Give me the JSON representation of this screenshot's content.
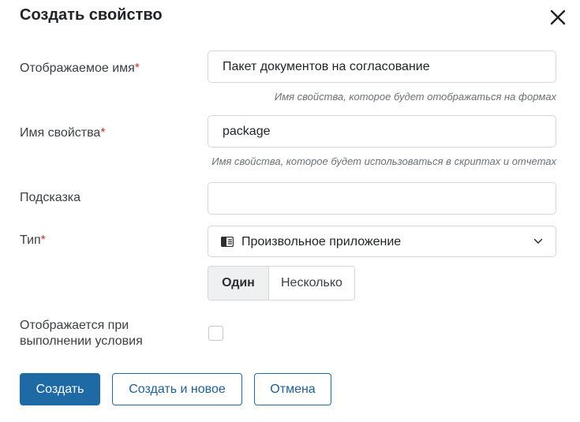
{
  "dialog": {
    "title": "Создать свойство",
    "close_icon": "close-icon"
  },
  "fields": {
    "display_name": {
      "label": "Отображаемое имя",
      "required_mark": "*",
      "value": "Пакет документов на согласование",
      "hint": "Имя свойства, которое будет отображаться на формах"
    },
    "property_name": {
      "label": "Имя свойства",
      "required_mark": "*",
      "value": "package",
      "hint": "Имя свойства, которое будет использоваться в скриптах и отчетах"
    },
    "tooltip": {
      "label": "Подсказка",
      "value": ""
    },
    "type": {
      "label": "Тип",
      "required_mark": "*",
      "icon": "app-icon",
      "selected": "Произвольное приложение",
      "mode_options": [
        "Один",
        "Несколько"
      ],
      "mode_selected": "Один"
    },
    "conditional": {
      "label_line1": "Отображается при",
      "label_line2": "выполнении условия",
      "checked": false
    }
  },
  "buttons": {
    "create": "Создать",
    "create_and_new": "Создать и новое",
    "cancel": "Отмена"
  },
  "colors": {
    "primary": "#1d6aa5",
    "required": "#d0312d"
  }
}
